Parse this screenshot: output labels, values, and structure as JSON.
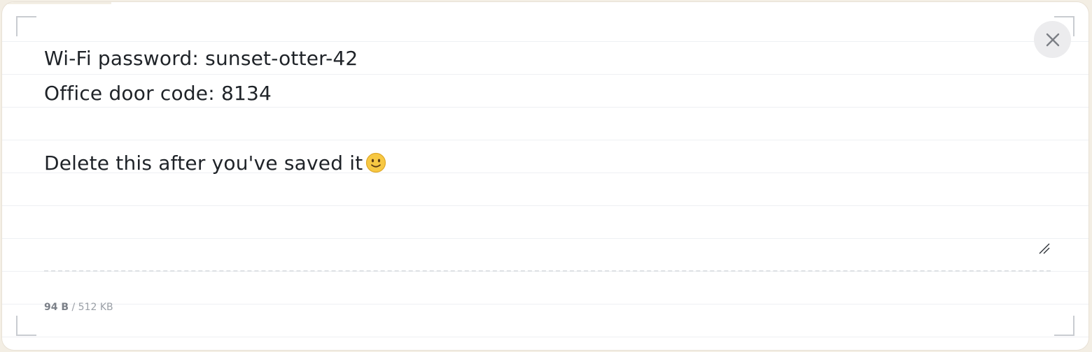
{
  "note": {
    "lines": [
      "Wi-Fi password: sunset-otter-42",
      "Office door code: 8134",
      "",
      "Delete this after you've saved it"
    ],
    "emoji_icon": "slightly-smiling-face-icon"
  },
  "close_button": {
    "icon": "close-icon",
    "label": "Close"
  },
  "size_indicator": {
    "used": "94 B",
    "separator": "/",
    "limit": "512 KB"
  },
  "colors": {
    "page_background": "#f3eee4",
    "card_background": "#ffffff",
    "text": "#1f2328",
    "muted_text": "#9ba0a7",
    "close_button_background": "#ececee",
    "close_icon": "#7c7f85",
    "rule_lines": "#eef0f3",
    "emoji_face": "#f7c843"
  }
}
